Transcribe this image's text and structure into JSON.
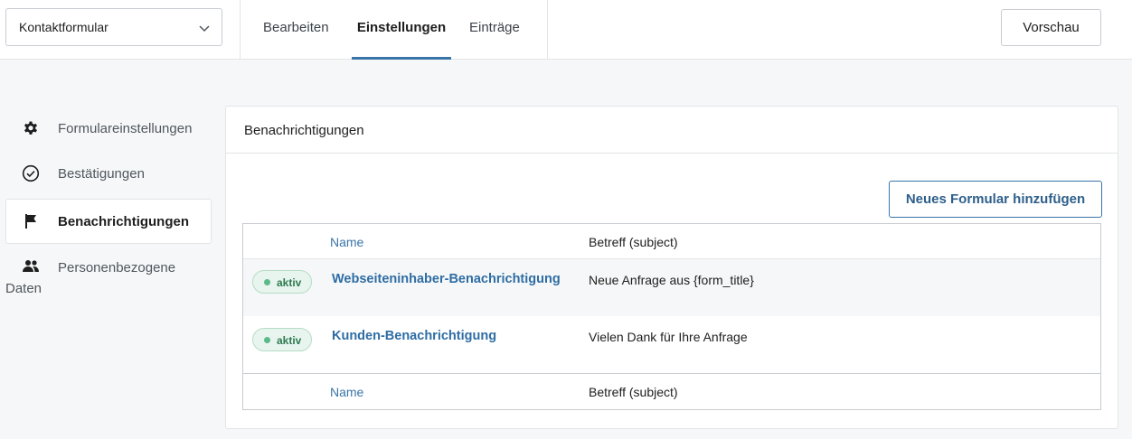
{
  "header": {
    "form_selector_value": "Kontaktformular",
    "tabs": [
      {
        "label": "Bearbeiten"
      },
      {
        "label": "Einstellungen"
      },
      {
        "label": "Einträge"
      }
    ],
    "active_tab": "Einstellungen",
    "preview_label": "Vorschau"
  },
  "sidebar": {
    "items": [
      {
        "label": "Formulareinstellungen",
        "icon": "gear-icon"
      },
      {
        "label": "Bestätigungen",
        "icon": "check-circle-icon"
      },
      {
        "label": "Benachrichtigungen",
        "icon": "flag-icon"
      },
      {
        "label_line1": "Personenbezogene",
        "label_line2": "Daten",
        "icon": "people-icon"
      }
    ],
    "active_item": "Benachrichtigungen"
  },
  "panel": {
    "title": "Benachrichtigungen",
    "add_button_label": "Neues Formular hinzufügen",
    "table": {
      "col_name": "Name",
      "col_subject": "Betreff (subject)",
      "rows": [
        {
          "status": "aktiv",
          "name": "Webseiteninhaber-Benachrichtigung",
          "subject": "Neue Anfrage aus {form_title}"
        },
        {
          "status": "aktiv",
          "name": "Kunden-Benachrichtigung",
          "subject": "Vielen Dank für Ihre Anfrage"
        }
      ],
      "footer_col_name": "Name",
      "footer_col_subject": "Betreff (subject)"
    }
  },
  "colors": {
    "accent": "#3a75a8",
    "link": "#2e6da4",
    "status_active_bg": "#e8f5ee",
    "status_active_dot": "#5bb98a"
  }
}
